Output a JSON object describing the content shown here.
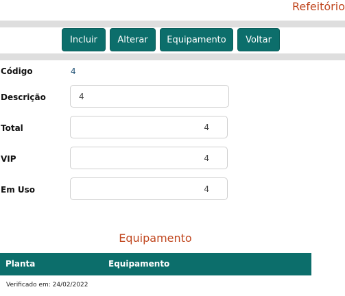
{
  "page": {
    "title": "Refeitório"
  },
  "toolbar": {
    "buttons": [
      {
        "label": "Incluir"
      },
      {
        "label": "Alterar"
      },
      {
        "label": "Equipamento"
      },
      {
        "label": "Voltar"
      }
    ]
  },
  "form": {
    "codigo": {
      "label": "Código",
      "value": "4"
    },
    "descricao": {
      "label": "Descrição",
      "value": "4"
    },
    "total": {
      "label": "Total",
      "value": "4"
    },
    "vip": {
      "label": "VIP",
      "value": "4"
    },
    "em_uso": {
      "label": "Em Uso",
      "value": "4"
    }
  },
  "equipment": {
    "title": "Equipamento",
    "columns": [
      "Planta",
      "Equipamento"
    ]
  },
  "footer": {
    "verified": "Verificado em: 24/02/2022"
  },
  "colors": {
    "accent": "#0c6e6b",
    "title": "#c0461e",
    "band": "#dedede"
  }
}
